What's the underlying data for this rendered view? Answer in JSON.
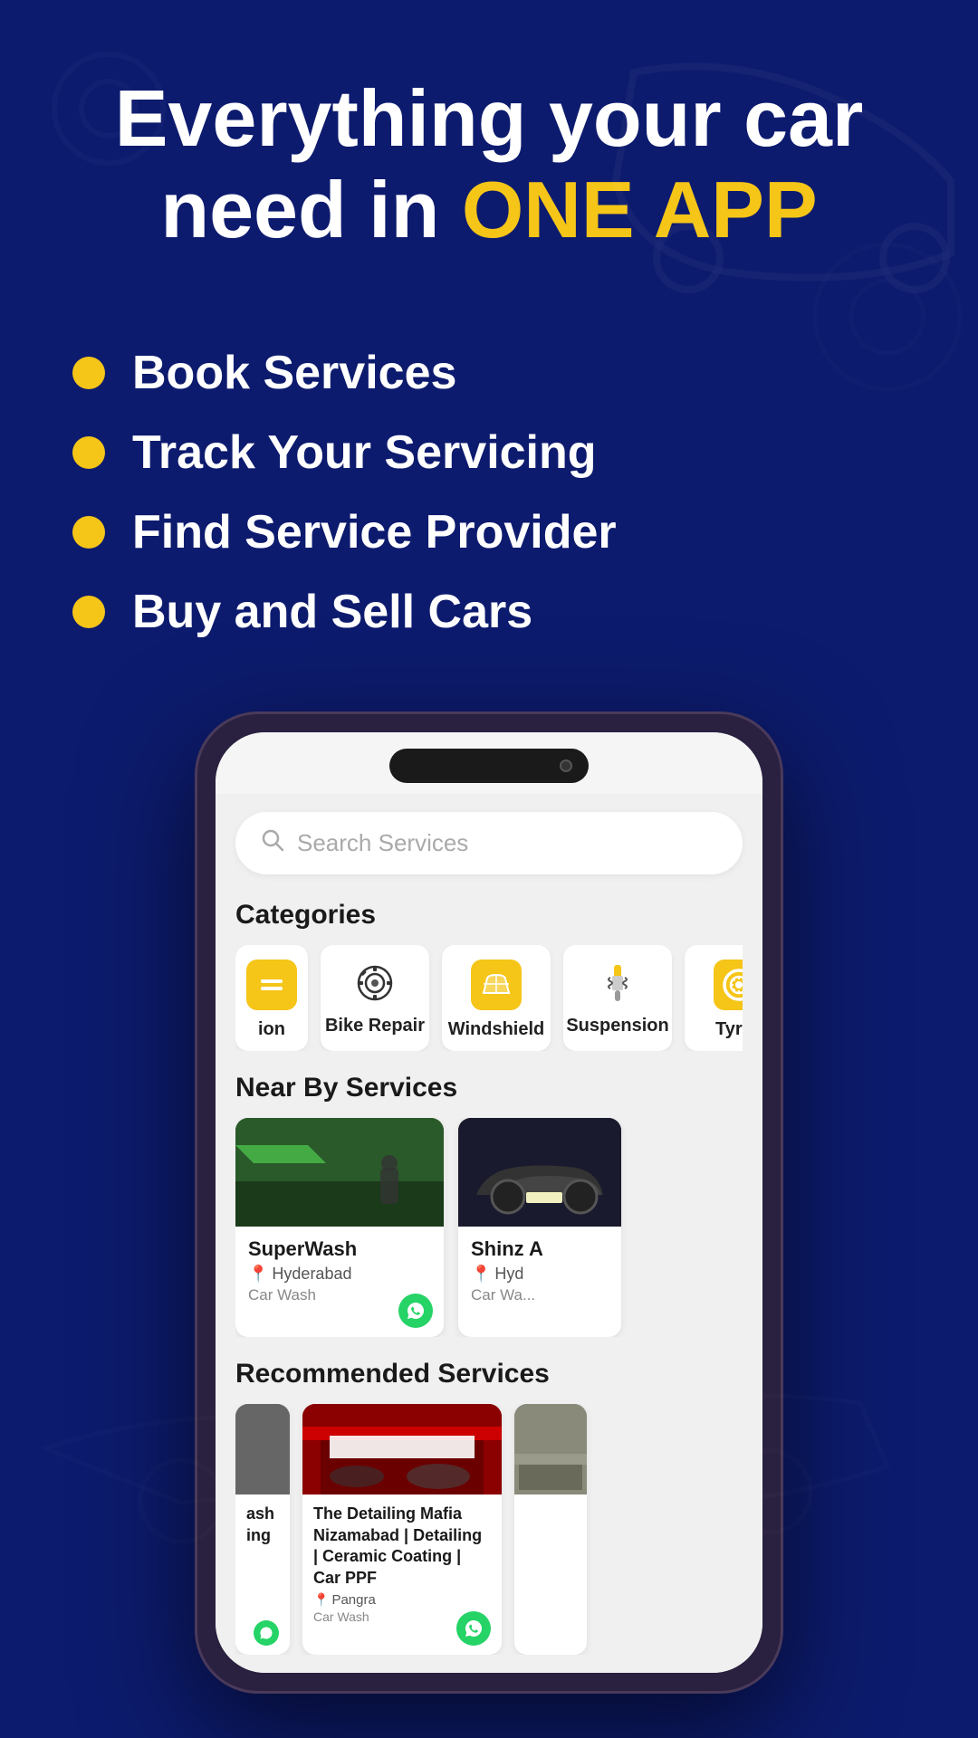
{
  "hero": {
    "title_line1": "Everything your car",
    "title_line2": "need in ",
    "title_highlight": "ONE APP",
    "features": [
      {
        "id": "book",
        "text": "Book Services"
      },
      {
        "id": "track",
        "text": "Track Your Servicing"
      },
      {
        "id": "find",
        "text": "Find Service Provider"
      },
      {
        "id": "buy",
        "text": "Buy and Sell Cars"
      }
    ]
  },
  "phone": {
    "search": {
      "placeholder": "Search Services"
    },
    "categories": {
      "title": "Categories",
      "items": [
        {
          "id": "partial",
          "label": "ion",
          "icon": "🔩",
          "bg": "yellow"
        },
        {
          "id": "bike-repair",
          "label": "Bike Repair",
          "icon": "⚙️",
          "bg": "none"
        },
        {
          "id": "windshield",
          "label": "Windshield",
          "icon": "🟨",
          "bg": "yellow"
        },
        {
          "id": "suspension",
          "label": "Suspension",
          "icon": "🔧",
          "bg": "none"
        },
        {
          "id": "tyres",
          "label": "Tyres",
          "icon": "⭕",
          "bg": "yellow"
        }
      ]
    },
    "nearby": {
      "title": "Near By Services",
      "items": [
        {
          "id": "superwash",
          "name": "SuperWash",
          "location": "Hyderabad",
          "type": "Car Wash",
          "img_color": "green"
        },
        {
          "id": "shinz",
          "name": "Shinz A",
          "location": "Hyd",
          "type": "Car Wa...",
          "img_color": "dark"
        }
      ]
    },
    "recommended": {
      "title": "Recommended Services",
      "items": [
        {
          "id": "partial-left",
          "name": "ash\ning",
          "location": "",
          "type": "",
          "img_color": "shop"
        },
        {
          "id": "detailing-mafia",
          "name": "The Detailing Mafia Nizamabad | Detailing | Ceramic Coating | Car PPF",
          "location": "Pangra",
          "type": "Car Wash",
          "img_color": "red"
        },
        {
          "id": "partial-right",
          "name": "",
          "location": "",
          "type": "",
          "img_color": "shop"
        }
      ]
    }
  },
  "colors": {
    "bg_dark": "#0d1b6e",
    "accent_yellow": "#f5c518",
    "white": "#ffffff",
    "whatsapp": "#25D366"
  }
}
